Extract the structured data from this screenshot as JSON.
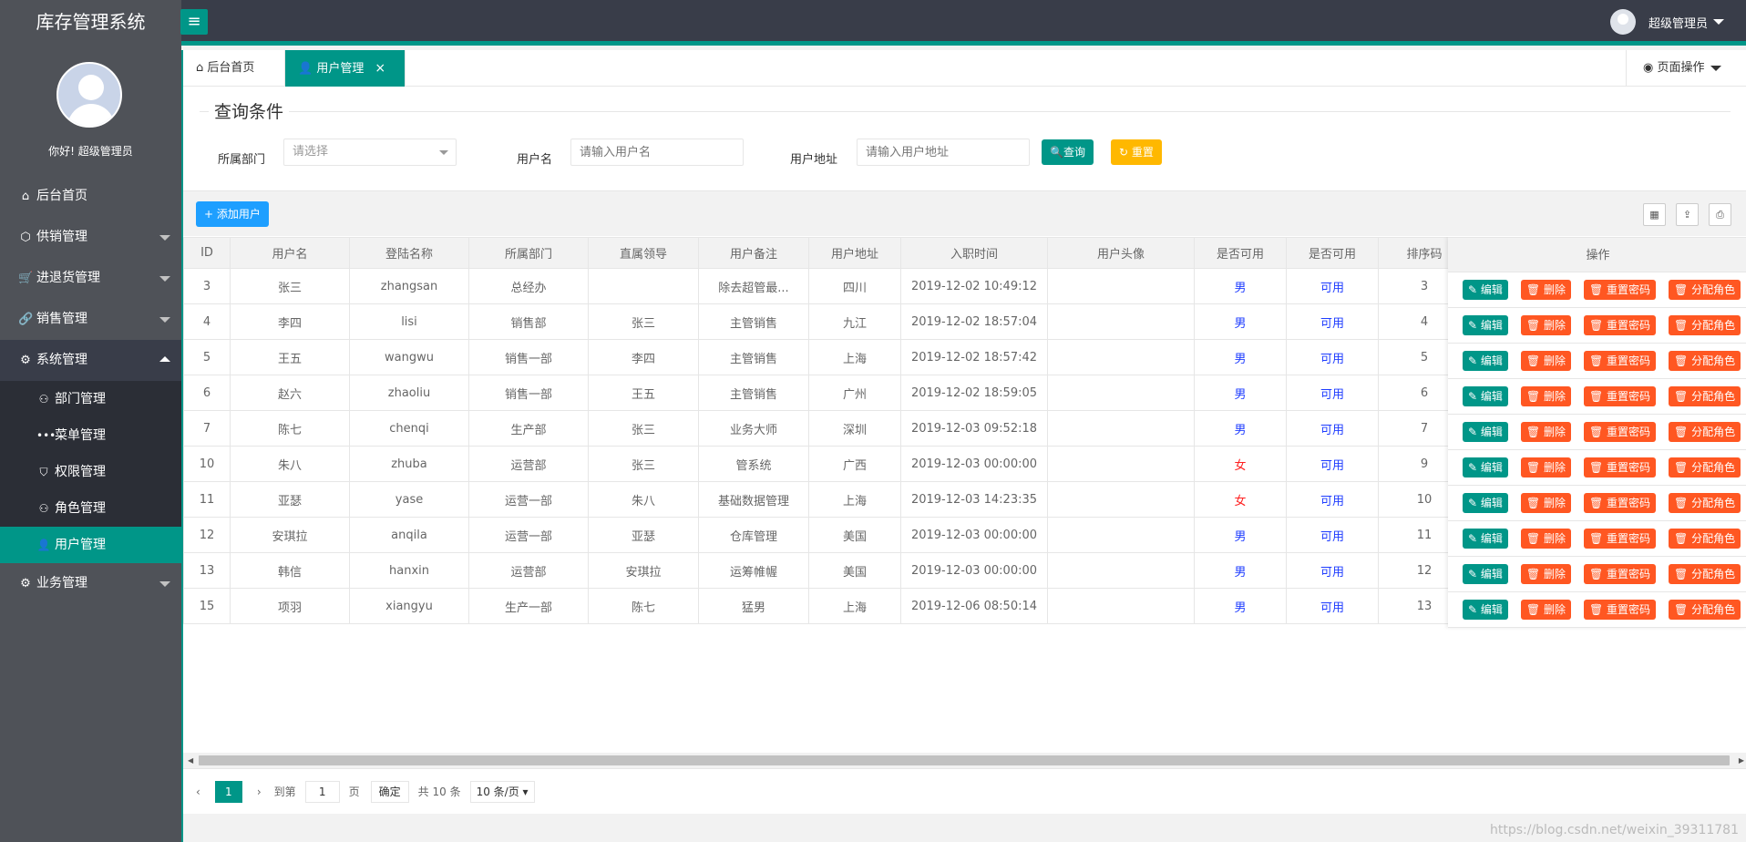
{
  "header": {
    "app_title": "库存管理系统",
    "user_name": "超级管理员"
  },
  "sidebar": {
    "greeting": "你好! 超级管理员",
    "items": [
      {
        "label": "后台首页",
        "icon": "home-icon"
      },
      {
        "label": "供销管理",
        "icon": "cube-icon"
      },
      {
        "label": "进退货管理",
        "icon": "cart-icon"
      },
      {
        "label": "销售管理",
        "icon": "link-icon"
      },
      {
        "label": "系统管理",
        "icon": "gear-icon"
      },
      {
        "label": "业务管理",
        "icon": "gear-icon"
      }
    ],
    "sub_items": [
      {
        "label": "部门管理",
        "icon": "user-outline-icon"
      },
      {
        "label": "菜单管理",
        "icon": "dots-icon"
      },
      {
        "label": "权限管理",
        "icon": "shield-icon"
      },
      {
        "label": "角色管理",
        "icon": "user-outline-icon"
      },
      {
        "label": "用户管理",
        "icon": "user-icon"
      }
    ]
  },
  "tabs": {
    "home": "后台首页",
    "user": "用户管理",
    "page_ops": "页面操作"
  },
  "query": {
    "title": "查询条件",
    "dept_label": "所属部门",
    "dept_placeholder": "请选择",
    "username_label": "用户名",
    "username_placeholder": "请输入用户名",
    "address_label": "用户地址",
    "address_placeholder": "请输入用户地址",
    "search_btn": "查询",
    "reset_btn": "重置"
  },
  "toolbar": {
    "add_btn": "添加用户"
  },
  "table": {
    "headers": [
      "ID",
      "用户名",
      "登陆名称",
      "所属部门",
      "直属领导",
      "用户备注",
      "用户地址",
      "入职时间",
      "用户头像",
      "是否可用",
      "是否可用",
      "排序码"
    ],
    "ops_header": "操作",
    "ops": {
      "edit": "编辑",
      "delete": "删除",
      "reset_pwd": "重置密码",
      "assign_role": "分配角色"
    },
    "rows": [
      [
        "3",
        "张三",
        "zhangsan",
        "总经办",
        "",
        "除去超管最...",
        "四川",
        "2019-12-02 10:49:12",
        "",
        "男",
        "可用",
        "3"
      ],
      [
        "4",
        "李四",
        "lisi",
        "销售部",
        "张三",
        "主管销售",
        "九江",
        "2019-12-02 18:57:04",
        "",
        "男",
        "可用",
        "4"
      ],
      [
        "5",
        "王五",
        "wangwu",
        "销售一部",
        "李四",
        "主管销售",
        "上海",
        "2019-12-02 18:57:42",
        "",
        "男",
        "可用",
        "5"
      ],
      [
        "6",
        "赵六",
        "zhaoliu",
        "销售一部",
        "王五",
        "主管销售",
        "广州",
        "2019-12-02 18:59:05",
        "",
        "男",
        "可用",
        "6"
      ],
      [
        "7",
        "陈七",
        "chenqi",
        "生产部",
        "张三",
        "业务大师",
        "深圳",
        "2019-12-03 09:52:18",
        "",
        "男",
        "可用",
        "7"
      ],
      [
        "10",
        "朱八",
        "zhuba",
        "运营部",
        "张三",
        "管系统",
        "广西",
        "2019-12-03 00:00:00",
        "",
        "女",
        "可用",
        "9"
      ],
      [
        "11",
        "亚瑟",
        "yase",
        "运营一部",
        "朱八",
        "基础数据管理",
        "上海",
        "2019-12-03 14:23:35",
        "",
        "女",
        "可用",
        "10"
      ],
      [
        "12",
        "安琪拉",
        "anqila",
        "运营一部",
        "亚瑟",
        "仓库管理",
        "美国",
        "2019-12-03 00:00:00",
        "",
        "男",
        "可用",
        "11"
      ],
      [
        "13",
        "韩信",
        "hanxin",
        "运营部",
        "安琪拉",
        "运筹帷幄",
        "美国",
        "2019-12-03 00:00:00",
        "",
        "男",
        "可用",
        "12"
      ],
      [
        "15",
        "项羽",
        "xiangyu",
        "生产一部",
        "陈七",
        "猛男",
        "上海",
        "2019-12-06 08:50:14",
        "",
        "男",
        "可用",
        "13"
      ]
    ]
  },
  "pager": {
    "current": "1",
    "goto_label": "到第",
    "page_input": "1",
    "page_unit": "页",
    "confirm": "确定",
    "total": "共 10 条",
    "page_size": "10 条/页"
  },
  "watermark": "https://blog.csdn.net/weixin_39311781",
  "colors": {
    "accent": "#009688",
    "danger": "#ff5722",
    "warning": "#ffb800",
    "primary": "#1e9fff",
    "sidebar": "#4f5258",
    "header": "#393d49"
  }
}
